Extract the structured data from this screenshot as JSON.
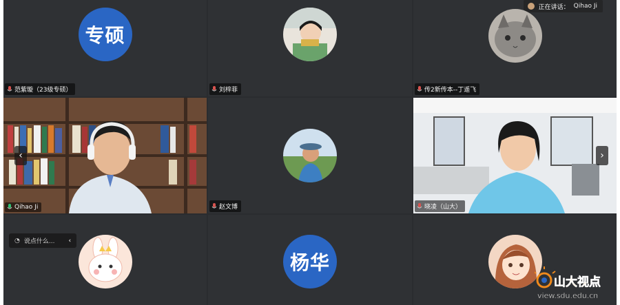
{
  "speaking_indicator": {
    "label": "正在讲话：",
    "speaker": "Qihao Ji"
  },
  "chat_input": {
    "placeholder": "说点什么..."
  },
  "participants": [
    {
      "name": "范紫璇（23级专硕）",
      "avatar_text": "专硕",
      "kind": "text"
    },
    {
      "name": "刘梓菲",
      "kind": "photo"
    },
    {
      "name": "传2新传本--丁遥飞",
      "kind": "photo"
    },
    {
      "name": "Qihao Ji",
      "kind": "video"
    },
    {
      "name": "赵文博",
      "kind": "photo"
    },
    {
      "name": "晓凌（山大）",
      "kind": "video"
    },
    {
      "name": "",
      "kind": "photo"
    },
    {
      "name": "",
      "avatar_text": "杨华",
      "kind": "text"
    },
    {
      "name": "",
      "kind": "photo"
    }
  ],
  "watermark": {
    "brand": "山大视点",
    "url": "view.sdu.edu.cn"
  },
  "colors": {
    "active_border": "#2fbf71",
    "avatar_blue": "#2a66c4",
    "tile_bg": "#2f3134"
  }
}
